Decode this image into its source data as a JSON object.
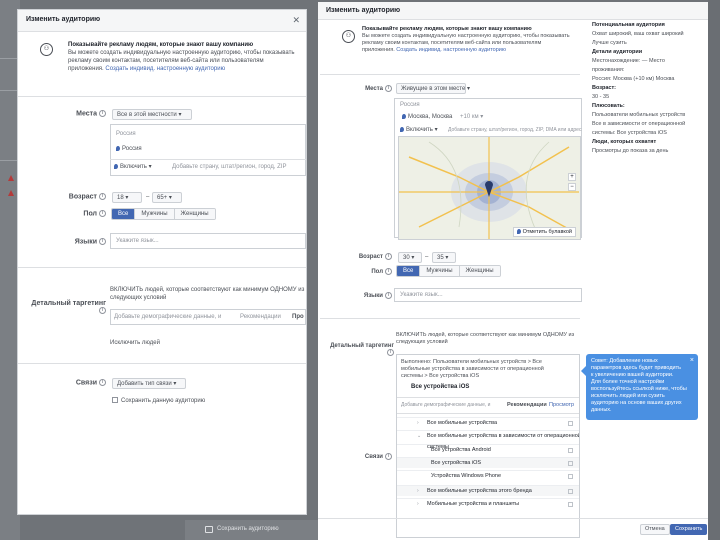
{
  "left_modal": {
    "title": "Изменить аудиторию",
    "intro_title": "Показывайте рекламу людям, которые знают вашу компанию",
    "intro_text_1": "Вы можете создать индивидуальную настроенную аудиторию, чтобы показывать",
    "intro_text_2": "рекламу своим контактам, посетителям веб-сайта или пользователям",
    "intro_text_3": "приложения.",
    "intro_link": "Создать индивид. настроенную аудиторию",
    "places_label": "Места",
    "places_dropdown": "Все в этой местности",
    "country_group": "Россия",
    "country": "Россия",
    "include_dropdown": "Включить",
    "location_placeholder": "Добавьте страну, штат/регион, город, ZIP",
    "age_label": "Возраст",
    "age_from": "18",
    "age_to": "65+",
    "gender_label": "Пол",
    "gender_options": [
      "Все",
      "Мужчины",
      "Женщины"
    ],
    "languages_label": "Языки",
    "languages_placeholder": "Укажите язык...",
    "detailed_label": "Детальный таргетинг",
    "detailed_text_1": "ВКЛЮЧИТЬ людей, которые соответствуют как минимум ОДНОМУ из",
    "detailed_text_2": "следующих условий",
    "detailed_placeholder": "Добавьте демографические данные, и",
    "detailed_btn_1": "Рекомендации",
    "detailed_btn_2": "Про",
    "exclude_link": "Исключить людей",
    "connections_label": "Связи",
    "connections_dropdown": "Добавить тип связи",
    "save_audience": "Сохранить данную аудиторию"
  },
  "right_modal": {
    "title": "Изменить аудиторию",
    "intro_title": "Показывайте рекламу людям, которые знают вашу компанию",
    "intro_text_1": "Вы можете создать индивидуальную настроенную аудиторию, чтобы показывать",
    "intro_text_2": "рекламу своим контактам, посетителям веб-сайта или пользователям",
    "intro_text_3": "приложения.",
    "intro_link": "Создать индивид. настроенную аудиторию",
    "places_label": "Места",
    "places_dropdown": "Живущие в этом месте",
    "country_group": "Россия",
    "city": "Москва, Москва",
    "radius": "+10 км",
    "include_dropdown": "Включить",
    "location_placeholder": "Добавьте страну, штат/регион, город, ZIP, DMA или адрес",
    "map_button": "Отметить булавкой",
    "age_label": "Возраст",
    "age_from": "30",
    "age_to": "35",
    "gender_label": "Пол",
    "gender_options": [
      "Все",
      "Мужчины",
      "Женщины"
    ],
    "languages_label": "Языки",
    "languages_placeholder": "Укажите язык...",
    "detailed_label": "Детальный таргетинг",
    "detailed_text_1": "ВКЛЮЧИТЬ людей, которые соответствуют как минимум ОДНОМУ из",
    "detailed_text_2": "следующих условий",
    "connections_label": "Связи",
    "devices_note_1": "Выполнено: Пользователи мобильных устройств > Все",
    "devices_note_2": "мобильные устройства в зависимости от операционной",
    "devices_note_3": "системы > Все устройства iOS",
    "devices_selected": "Все устройства iOS",
    "devices_placeholder": "Добавьте демографические данные, и",
    "devices_btn_1": "Рекомендации",
    "devices_btn_2": "Просмотр",
    "device_rows": [
      "Все мобильные устройства",
      "Все мобильные устройства в зависимости от операционной системы",
      "Все устройства Android",
      "Все устройства iOS",
      "Устройства Windows Phone",
      "Все мобильные устройства этого бренда",
      "Мобильные устройства и планшеты"
    ],
    "cancel": "Отмена",
    "save": "Сохранить"
  },
  "summary": {
    "potential_h": "Потенциальная аудитория",
    "potential_1": "Охват широкий, ваш охват широкий",
    "potential_2": "Лучше сузить",
    "targeting_h": "Детали аудитории",
    "targeting_1": "Местонахождение: — Место",
    "targeting_2": "проживания:",
    "targeting_3": "Россия: Москва (+10 км) Москва",
    "age_h": "Возраст:",
    "age_v": "30 - 35",
    "include_h": "Плюсовать:",
    "include_1": "Пользователи мобильных устройств",
    "include_2": "Все в зависимости от операционной",
    "include_3": "системы: Все устройства iOS",
    "reach_h": "Люди, которых охватят",
    "reach_1": "Просмотры до показа за день"
  },
  "tooltip": {
    "text_1": "Совет: Добавление новых",
    "text_2": "параметров здесь будет приводить",
    "text_3": "к увеличению вашей аудитории.",
    "text_4": "Для более точной настройки",
    "text_5": "воспользуйтесь ссылкой ниже, чтобы",
    "text_6": "исключить людей или сузить",
    "text_7": "аудиторию на основе ваших других",
    "text_8": "данных."
  },
  "background": {
    "save_audience": "Сохранить аудиторию"
  }
}
